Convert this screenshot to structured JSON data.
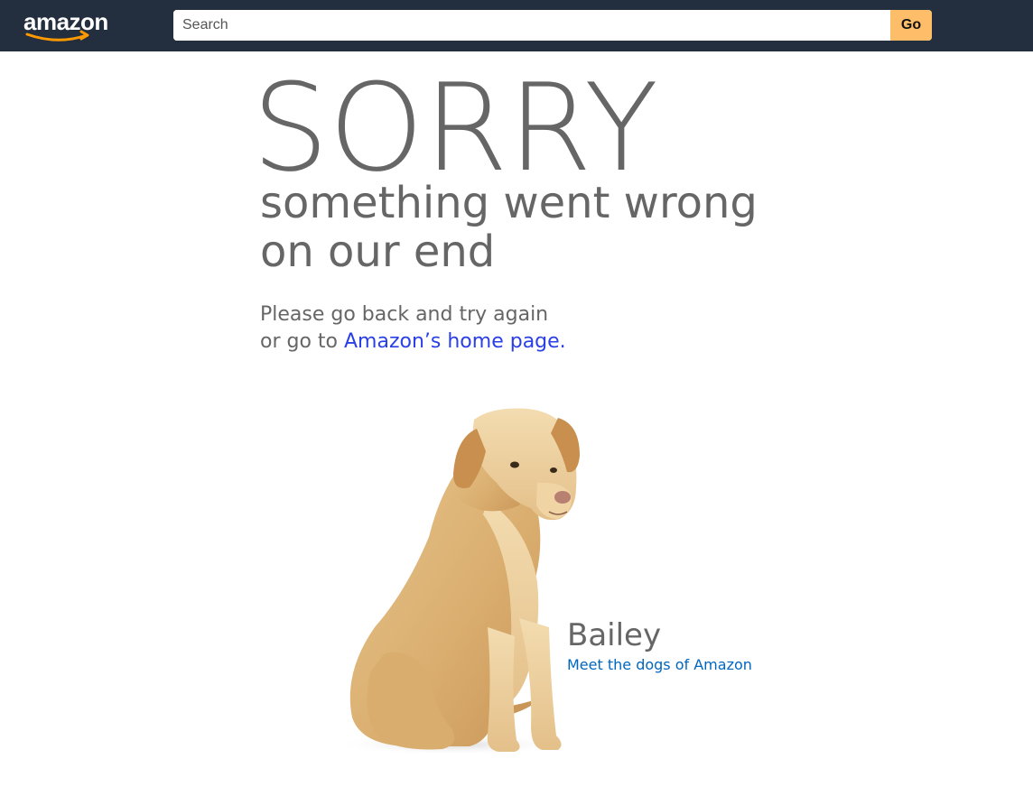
{
  "header": {
    "logo_text": "amazon",
    "search": {
      "placeholder": "Search",
      "value": ""
    },
    "go_label": "Go"
  },
  "main": {
    "headline": "SORRY",
    "subtitle_line1": "something went wrong",
    "subtitle_line2": "on our end",
    "message_line1": "Please go back and try again",
    "message_line2_prefix": "or go to ",
    "home_link_label": "Amazon’s home page.",
    "dog_name": "Bailey",
    "dogs_link_label": "Meet the dogs of Amazon"
  },
  "colors": {
    "header_bg": "#232f3e",
    "go_button": "#febd69",
    "text_gray": "#666666",
    "link_blue": "#2a40e6",
    "secondary_link": "#0066c0",
    "smile_orange": "#ff9900"
  },
  "icons": {
    "logo": "amazon-smile-logo",
    "dog": "labrador-dog-illustration"
  }
}
